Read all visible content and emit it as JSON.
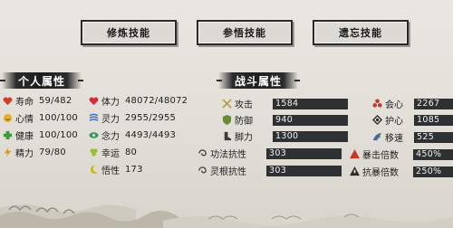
{
  "tabs": {
    "cultivate": "修炼技能",
    "insight": "参悟技能",
    "forget": "遗忘技能"
  },
  "personal": {
    "title": "个人属性",
    "left": [
      {
        "label": "寿命",
        "value": "59/482",
        "icon": "heart-icon",
        "color": "#d33b2b"
      },
      {
        "label": "心情",
        "value": "100/100",
        "icon": "smile-icon",
        "color": "#d59a22"
      },
      {
        "label": "健康",
        "value": "100/100",
        "icon": "cross-icon",
        "color": "#3b9a3b"
      },
      {
        "label": "精力",
        "value": "79/80",
        "icon": "bolt-icon",
        "color": "#d49a1c"
      }
    ],
    "right": [
      {
        "label": "体力",
        "value": "48072/48072",
        "icon": "heart-icon",
        "color": "#cf2f3a"
      },
      {
        "label": "灵力",
        "value": "2955/2955",
        "icon": "spirit-icon",
        "color": "#3f6ed0"
      },
      {
        "label": "念力",
        "value": "4493/4493",
        "icon": "eye-icon",
        "color": "#2f9a5a"
      },
      {
        "label": "幸运",
        "value": "80",
        "icon": "clover-icon",
        "color": "#9abf2f"
      },
      {
        "label": "悟性",
        "value": "173",
        "icon": "moon-icon",
        "color": "#c7b61f"
      }
    ]
  },
  "combat": {
    "title": "战斗属性",
    "left": [
      {
        "label": "攻击",
        "value": "1584",
        "icon": "sword-icon",
        "color": "#b89a3a"
      },
      {
        "label": "防御",
        "value": "940",
        "icon": "shield-icon",
        "color": "#6a8a3a"
      },
      {
        "label": "脚力",
        "value": "1300",
        "icon": "boot-icon",
        "color": "#3a3a3a"
      },
      {
        "label": "功法抗性",
        "value": "303",
        "icon": "swirl-icon",
        "color": "#3a3a3a"
      },
      {
        "label": "灵根抗性",
        "value": "303",
        "icon": "swirl-icon",
        "color": "#3a3a3a"
      }
    ],
    "right": [
      {
        "label": "会心",
        "value": "2267",
        "icon": "crit-icon",
        "color": "#c23a2a"
      },
      {
        "label": "护心",
        "value": "1085",
        "icon": "guard-icon",
        "color": "#2a2a2a"
      },
      {
        "label": "移速",
        "value": "525",
        "icon": "wing-icon",
        "color": "#4a6a9a"
      },
      {
        "label": "暴击倍数",
        "value": "450%",
        "icon": "crit-mult-icon",
        "color": "#c23a2a"
      },
      {
        "label": "抗暴倍数",
        "value": "250%",
        "icon": "anti-crit-icon",
        "color": "#2a2a2a"
      }
    ]
  }
}
